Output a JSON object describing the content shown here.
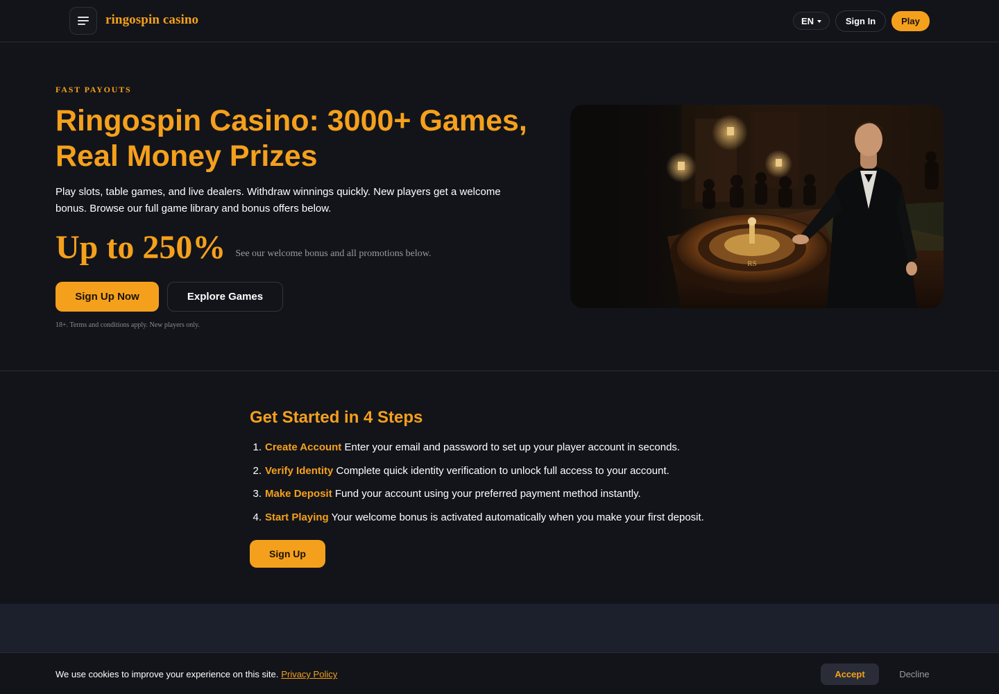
{
  "header": {
    "brand": "ringospin casino",
    "language": "EN",
    "signin_label": "Sign In",
    "play_label": "Play"
  },
  "hero": {
    "eyebrow": "FAST PAYOUTS",
    "title": "Ringospin Casino: 3000+ Games, Real Money Prizes",
    "description": "Play slots, table games, and live dealers. Withdraw winnings quickly. New players get a welcome bonus. Browse our full game library and bonus offers below.",
    "bonus_amount": "Up to 250%",
    "bonus_note": "See our welcome bonus and all promotions below.",
    "primary_cta": "Sign Up Now",
    "secondary_cta": "Explore Games",
    "disclaimer": "18+. Terms and conditions apply. New players only.",
    "image_monogram": "RS"
  },
  "steps": {
    "title": "Get Started in 4 Steps",
    "items": [
      {
        "num": "1.",
        "name": "Create Account",
        "text": "Enter your email and password to set up your player account in seconds."
      },
      {
        "num": "2.",
        "name": "Verify Identity",
        "text": "Complete quick identity verification to unlock full access to your account."
      },
      {
        "num": "3.",
        "name": "Make Deposit",
        "text": "Fund your account using your preferred payment method instantly."
      },
      {
        "num": "4.",
        "name": "Start Playing",
        "text": "Your welcome bonus is activated automatically when you make your first deposit."
      }
    ],
    "cta": "Sign Up"
  },
  "cookie": {
    "text": "We use cookies to improve your experience on this site.",
    "link": "Privacy Policy",
    "accept": "Accept",
    "decline": "Decline"
  },
  "colors": {
    "accent": "#f5a01c",
    "background": "#12141a",
    "lower_band": "#1c1f2c"
  },
  "icons": {
    "menu": "hamburger-menu-icon",
    "language_caret": "caret-down-icon"
  }
}
